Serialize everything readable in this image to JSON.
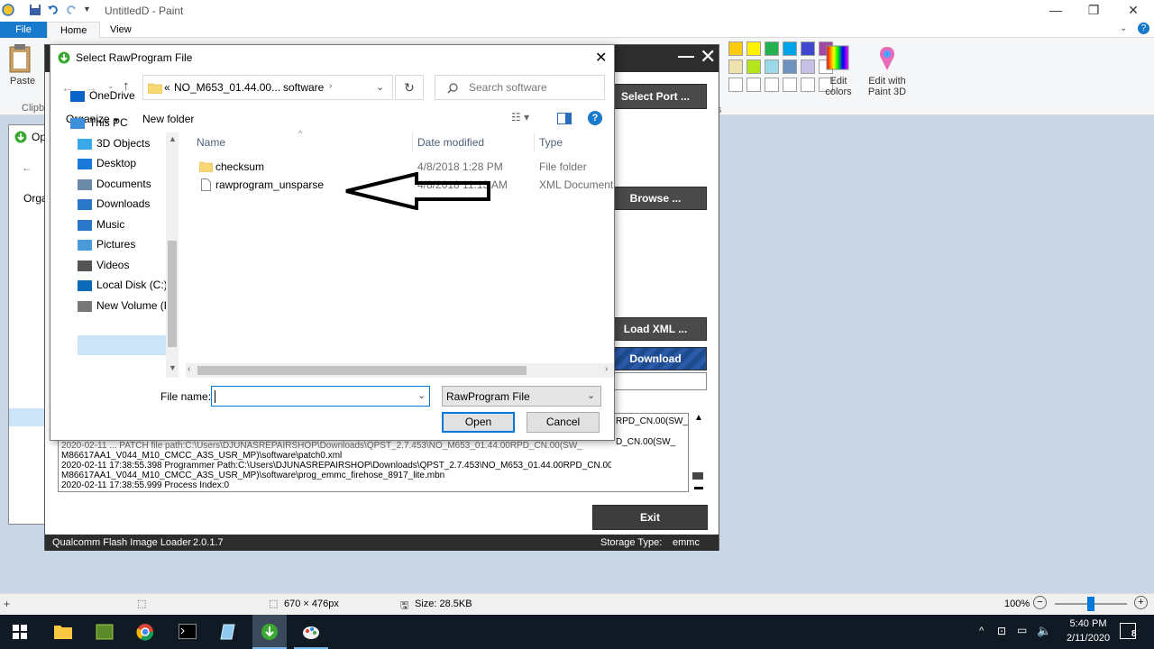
{
  "paint": {
    "title": "UntitledD - Paint",
    "tabs": {
      "file": "File",
      "home": "Home",
      "view": "View"
    },
    "ribbon": {
      "paste": "Paste",
      "clipboard": "Clipb",
      "edit_colors_1": "Edit",
      "edit_colors_2": "colors",
      "edit_paint3d_1": "Edit with",
      "edit_paint3d_2": "Paint 3D",
      "group_s": "s"
    },
    "swatches": [
      "#ffc90e",
      "#fff200",
      "#22b14c",
      "#00a2e8",
      "#3f48cc",
      "#a349a4",
      "#efe4b0",
      "#b5e61d",
      "#99d9ea",
      "#7092be",
      "#c8bfe7"
    ],
    "status": {
      "dimensions": "670 × 476px",
      "size": "Size: 28.5KB",
      "zoom": "100%"
    }
  },
  "qfil": {
    "select_port": "Select Port ...",
    "browse": "Browse ...",
    "load_xml": "Load XML ...",
    "download": "Download",
    "exit": "Exit",
    "footer_app": "Qualcomm Flash Image Loader",
    "footer_version": "2.0.1.7",
    "storage_label": "Storage Type:",
    "storage_value": "emmc",
    "log_partial_right": "RPD_CN.00(SW_",
    "log_partial_right2": "D_CN.00(SW_",
    "log_lines": [
      "2020-02-11 ... PATCH file path:C:\\Users\\DJUNASREPAIRSHOP\\Downloads\\QPST_2.7.453\\NO_M653_01.44.00RPD_CN.00(SW_",
      "M86617AA1_V044_M10_CMCC_A3S_USR_MP)\\software\\patch0.xml",
      "2020-02-11 17:38:55.398    Programmer Path:C:\\Users\\DJUNASREPAIRSHOP\\Downloads\\QPST_2.7.453\\NO_M653_01.44.00RPD_CN.00(SW_",
      "M86617AA1_V044_M10_CMCC_A3S_USR_MP)\\software\\prog_emmc_firehose_8917_lite.mbn",
      "2020-02-11 17:38:55.999    Process Index:0"
    ]
  },
  "bg_dialog": {
    "title": "Op",
    "organize": "Orga"
  },
  "dialog": {
    "title": "Select RawProgram File",
    "address": {
      "prefix": "«",
      "crumb1": "NO_M653_01.44.00...",
      "crumb2": "software"
    },
    "search_placeholder": "Search software",
    "organize": "Organize",
    "new_folder": "New folder",
    "nav": [
      {
        "label": "OneDrive",
        "icon": "cloud-icon"
      },
      {
        "label": "This PC",
        "icon": "computer-icon"
      },
      {
        "label": "3D Objects",
        "icon": "cube-icon"
      },
      {
        "label": "Desktop",
        "icon": "desktop-icon"
      },
      {
        "label": "Documents",
        "icon": "documents-icon"
      },
      {
        "label": "Downloads",
        "icon": "download-icon"
      },
      {
        "label": "Music",
        "icon": "music-icon"
      },
      {
        "label": "Pictures",
        "icon": "pictures-icon"
      },
      {
        "label": "Videos",
        "icon": "videos-icon"
      },
      {
        "label": "Local Disk (C:)",
        "icon": "disk-icon"
      },
      {
        "label": "New Volume (E:",
        "icon": "drive-icon"
      }
    ],
    "columns": {
      "name": "Name",
      "date": "Date modified",
      "type": "Type"
    },
    "files": [
      {
        "name": "checksum",
        "date": "4/8/2018 1:28 PM",
        "type": "File folder"
      },
      {
        "name": "rawprogram_unsparse",
        "date": "4/8/2018 11:13 AM",
        "type": "XML Document"
      }
    ],
    "filename_label": "File name:",
    "filename_value": "",
    "filter": "RawProgram File",
    "open": "Open",
    "cancel": "Cancel"
  },
  "taskbar": {
    "time": "5:40 PM",
    "date": "2/11/2020",
    "notif_count": "8"
  }
}
